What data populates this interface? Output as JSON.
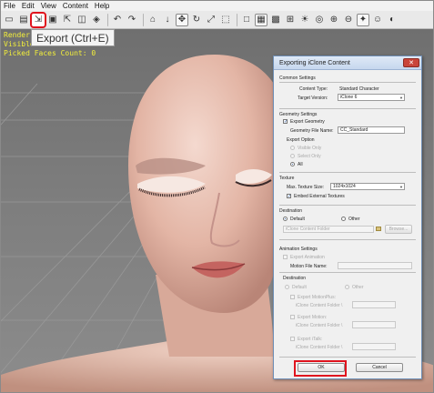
{
  "menu": [
    "File",
    "Edit",
    "View",
    "Content",
    "Help"
  ],
  "toolbar_icons": [
    "new-icon",
    "open-icon",
    "export-icon",
    "save-icon",
    "import-icon",
    "layers-icon",
    "undo-icon",
    "redo-icon",
    "home-icon",
    "down-arrow-icon",
    "move-icon",
    "rotate-icon",
    "scale-icon",
    "fit-icon",
    "box-icon",
    "solid-icon",
    "wire-icon",
    "grid-icon",
    "light-icon",
    "camera-icon",
    "zoom-in-icon",
    "zoom-out-icon",
    "select-icon",
    "face-icon",
    "render-icon"
  ],
  "tooltip": "Export (Ctrl+E)",
  "viewport": {
    "line1": "Render",
    "line2": "Visible",
    "line3": "Picked Faces Count: 0"
  },
  "dialog": {
    "title": "Exporting iClone Content",
    "close_label": "✕",
    "common": {
      "title": "Common Settings",
      "content_type_label": "Content Type:",
      "content_type_value": "Standard Character",
      "target_version_label": "Target Version:",
      "target_version_value": "iClone 6"
    },
    "geometry": {
      "title": "Geometry Settings",
      "export_geometry": "Export Geometry",
      "file_name_label": "Geometry File Name:",
      "file_name_value": "CC_Standard",
      "export_option": "Export Option",
      "visible_only": "Visible Only",
      "select_only": "Select Only",
      "all": "All"
    },
    "texture": {
      "title": "Texture",
      "max_size_label": "Max. Texture Size:",
      "max_size_value": "1024x1024",
      "embed": "Embed External Textures"
    },
    "destination": {
      "title": "Destination",
      "default": "Default",
      "other": "Other",
      "folder": "iClone Content Folder",
      "browse": "Browse..."
    },
    "animation": {
      "title": "Animation Settings",
      "export_animation": "Export Animation",
      "motion_file_label": "Motion File Name:",
      "destination": "Destination",
      "default": "Default",
      "other": "Other",
      "motionplus": "Export MotionPlus:",
      "motion": "Export Motion:",
      "italk": "Export iTalk:",
      "folder_path": "iClone Content Folder \\"
    },
    "ok": "OK",
    "cancel": "Cancel"
  }
}
